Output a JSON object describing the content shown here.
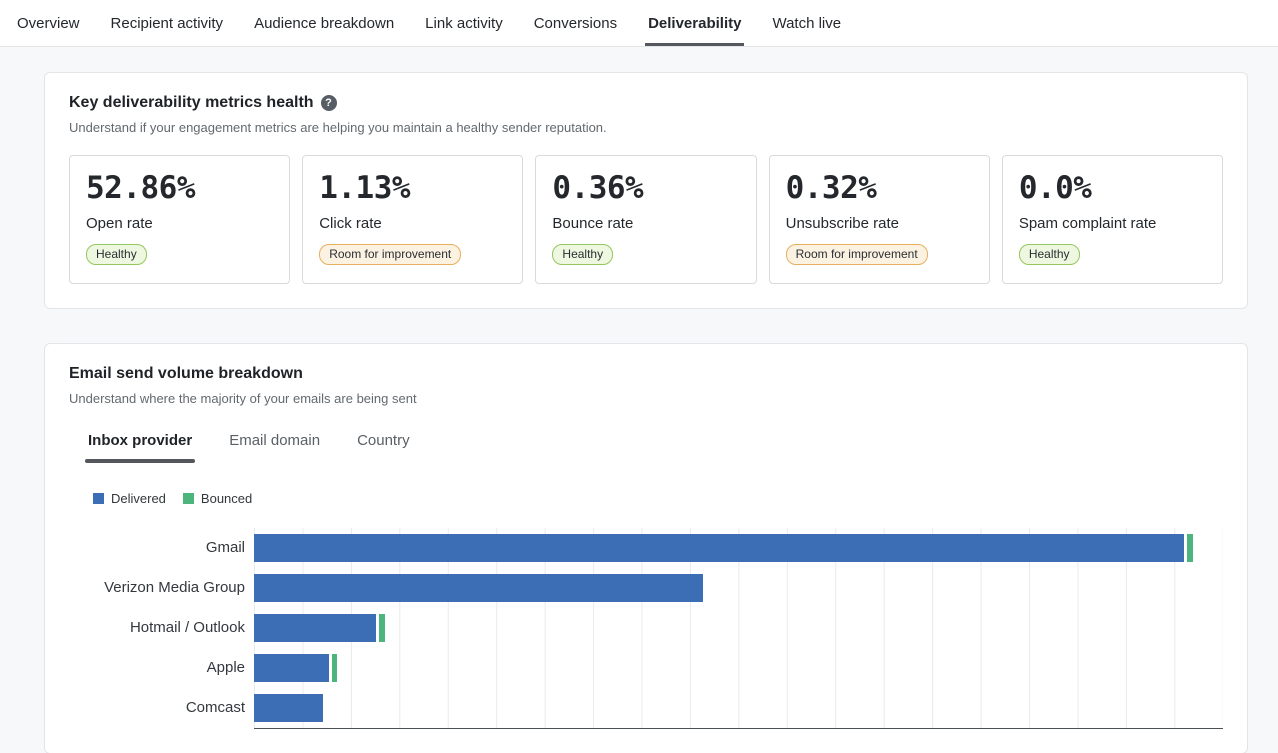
{
  "nav": {
    "tabs": [
      {
        "label": "Overview",
        "active": false
      },
      {
        "label": "Recipient activity",
        "active": false
      },
      {
        "label": "Audience breakdown",
        "active": false
      },
      {
        "label": "Link activity",
        "active": false
      },
      {
        "label": "Conversions",
        "active": false
      },
      {
        "label": "Deliverability",
        "active": true
      },
      {
        "label": "Watch live",
        "active": false
      }
    ]
  },
  "deliverability_card": {
    "title": "Key deliverability metrics health",
    "help_icon": "question-mark-icon",
    "subtitle": "Understand if your engagement metrics are helping you maintain a healthy sender reputation.",
    "metrics": [
      {
        "value": "52.86%",
        "label": "Open rate",
        "status": "Healthy",
        "status_type": "healthy"
      },
      {
        "value": "1.13%",
        "label": "Click rate",
        "status": "Room for improvement",
        "status_type": "warning"
      },
      {
        "value": "0.36%",
        "label": "Bounce rate",
        "status": "Healthy",
        "status_type": "healthy"
      },
      {
        "value": "0.32%",
        "label": "Unsubscribe rate",
        "status": "Room for improvement",
        "status_type": "warning"
      },
      {
        "value": "0.0%",
        "label": "Spam complaint rate",
        "status": "Healthy",
        "status_type": "healthy"
      }
    ]
  },
  "volume_card": {
    "title": "Email send volume breakdown",
    "subtitle": "Understand where the majority of your emails are being sent",
    "tabs": [
      {
        "label": "Inbox provider",
        "active": true
      },
      {
        "label": "Email domain",
        "active": false
      },
      {
        "label": "Country",
        "active": false
      }
    ],
    "legend": [
      {
        "label": "Delivered",
        "color": "#3b6eb4"
      },
      {
        "label": "Bounced",
        "color": "#4cb57d"
      }
    ]
  },
  "chart_data": {
    "type": "bar",
    "orientation": "horizontal",
    "title": "Email send volume breakdown by inbox provider",
    "categories": [
      "Gmail",
      "Verizon Media Group",
      "Hotmail / Outlook",
      "Apple",
      "Comcast"
    ],
    "series": [
      {
        "name": "Delivered",
        "color": "#3b6eb4",
        "values": [
          9600,
          4630,
          1260,
          770,
          710
        ]
      },
      {
        "name": "Bounced",
        "color": "#4cb57d",
        "values": [
          60,
          0,
          60,
          55,
          0
        ]
      }
    ],
    "xlim": [
      0,
      10000
    ],
    "gridline_interval": 500,
    "grid": true,
    "legend_position": "top-left",
    "xlabel": "",
    "ylabel": ""
  },
  "colors": {
    "delivered_bar": "#3b6eb4",
    "bounced_bar": "#4cb57d",
    "healthy_badge_bg": "#eef7e0",
    "healthy_badge_border": "#94c75e",
    "warning_badge_bg": "#fcf2e2",
    "warning_badge_border": "#e7af5e",
    "active_tab_underline": "#54585d"
  }
}
